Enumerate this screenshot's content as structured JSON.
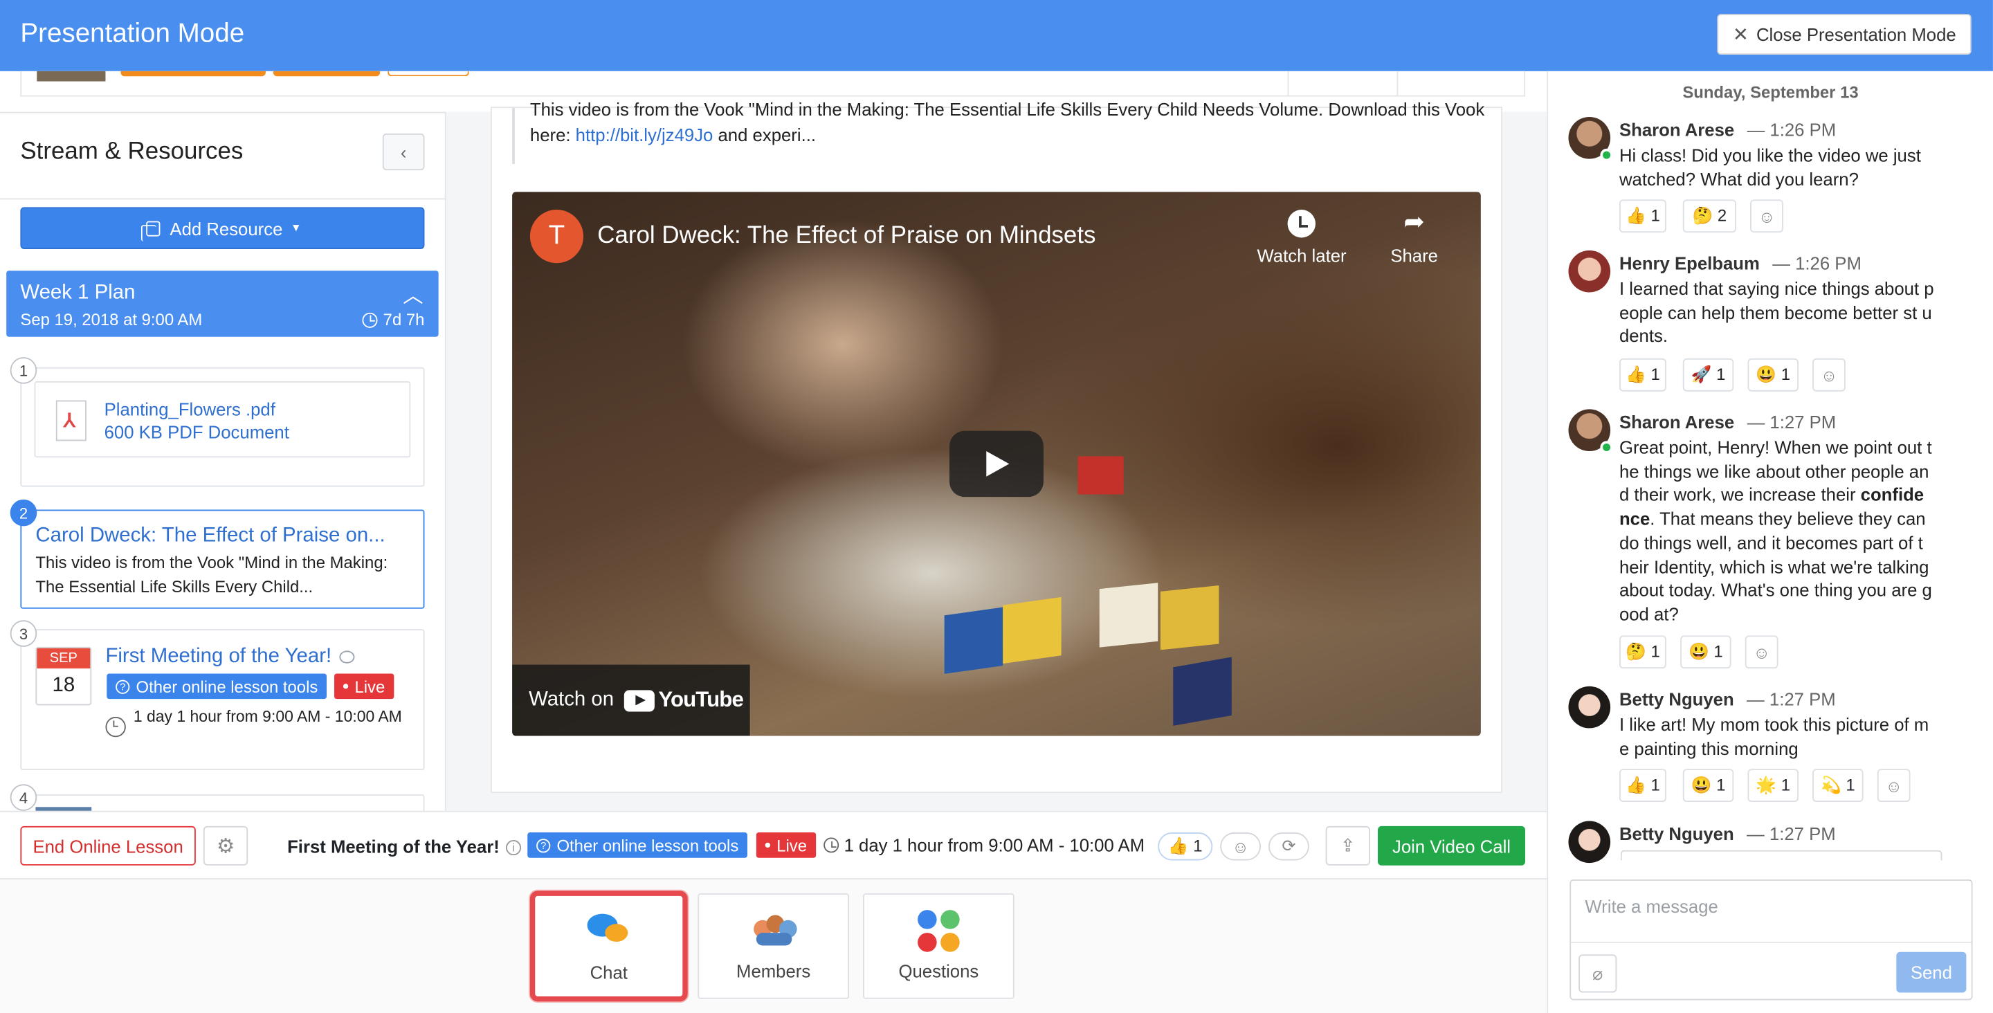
{
  "header": {
    "title": "Presentation Mode",
    "close_label": "Close Presentation Mode"
  },
  "left": {
    "heading": "Stream & Resources",
    "add_resource_label": "Add Resource",
    "week": {
      "title": "Week 1 Plan",
      "date": "Sep 19, 2018 at 9:00 AM",
      "duration": "7d 7h"
    },
    "items": [
      {
        "num": "1",
        "file_name": "Planting_Flowers .pdf",
        "file_meta": "600 KB PDF Document"
      },
      {
        "num": "2",
        "title": "Carol Dweck: The Effect of Praise on...",
        "desc": "This video is from the Vook \"Mind in the Making: The Essential Life Skills Every Child..."
      },
      {
        "num": "3",
        "month": "SEP",
        "day": "18",
        "title": "First Meeting of the Year!",
        "tag_tools": "Other online lesson tools",
        "tag_live": "Live",
        "time": "1 day 1 hour from 9:00 AM - 10:00 AM"
      },
      {
        "num": "4"
      }
    ]
  },
  "main": {
    "desc_text": "This video is from the Vook \"Mind in the Making: The Essential Life Skills Every Child Needs Volume. Download this Vook here:",
    "desc_link": "http://bit.ly/jz49Jo",
    "desc_tail": "and experi...",
    "video": {
      "avatar_letter": "T",
      "title": "Carol Dweck: The Effect of Praise on Mindsets",
      "watch_later": "Watch later",
      "share": "Share",
      "watch_on": "Watch on",
      "youtube": "YouTube"
    }
  },
  "lesson_bar": {
    "end_label": "End Online Lesson",
    "title": "First Meeting of the Year!",
    "tag_tools": "Other online lesson tools",
    "tag_live": "Live",
    "time": "1 day 1 hour from 9:00 AM - 10:00 AM",
    "reaction": "👍 1",
    "join_label": "Join Video Call"
  },
  "tabs": [
    {
      "label": "Chat"
    },
    {
      "label": "Members"
    },
    {
      "label": "Questions"
    }
  ],
  "chat": {
    "date": "Sunday, September 13",
    "messages": [
      {
        "name": "Sharon Arese",
        "time": "— 1:26 PM",
        "text": "Hi class! Did you like the video we just watched? What did you learn?",
        "reactions": [
          "👍 1",
          "🤔 2"
        ]
      },
      {
        "name": "Henry Epelbaum",
        "time": "— 1:26 PM",
        "text": "I learned that saying nice things about people can help them become better st udents.",
        "reactions": [
          "👍 1",
          "🚀 1",
          "😃 1"
        ]
      },
      {
        "name": "Sharon Arese",
        "time": "— 1:27 PM",
        "text_a": "Great point, Henry! When we point out t he things we like about other people an d their work, we increase their ",
        "text_bold": "confide nce",
        "text_b": ". That means they believe they can do things well, and it becomes part of t heir Identity, which is what we're talking about today. What's one thing you are g ood at?",
        "reactions": [
          "🤔 1",
          "😃 1"
        ]
      },
      {
        "name": "Betty Nguyen",
        "time": "— 1:27 PM",
        "text": "I like art! My mom took this picture of m e painting this morning",
        "reactions": [
          "👍 1",
          "😃 1",
          "🌟 1",
          "💫 1"
        ]
      },
      {
        "name": "Betty Nguyen",
        "time": "— 1:27 PM"
      }
    ],
    "placeholder": "Write a message",
    "send_label": "Send"
  }
}
